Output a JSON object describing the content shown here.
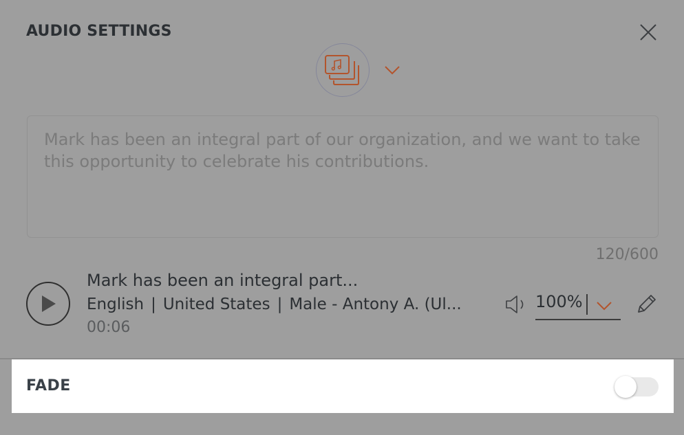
{
  "dialog": {
    "title": "AUDIO SETTINGS"
  },
  "voice": {
    "icon": "music-stack-icon",
    "accent_color": "#b3542c"
  },
  "text_input": {
    "value": "Mark has been an integral part of our organization, and we want to take this opportunity to celebrate his contributions."
  },
  "char_counter": "120/600",
  "clip": {
    "title": "Mark has been an integral part...",
    "language": "English",
    "region": "United States",
    "voice": "Male - Antony A. (Ul...",
    "separator": "|",
    "duration": "00:06"
  },
  "volume": {
    "value": "100%"
  },
  "fade": {
    "label": "FADE",
    "enabled": false
  }
}
